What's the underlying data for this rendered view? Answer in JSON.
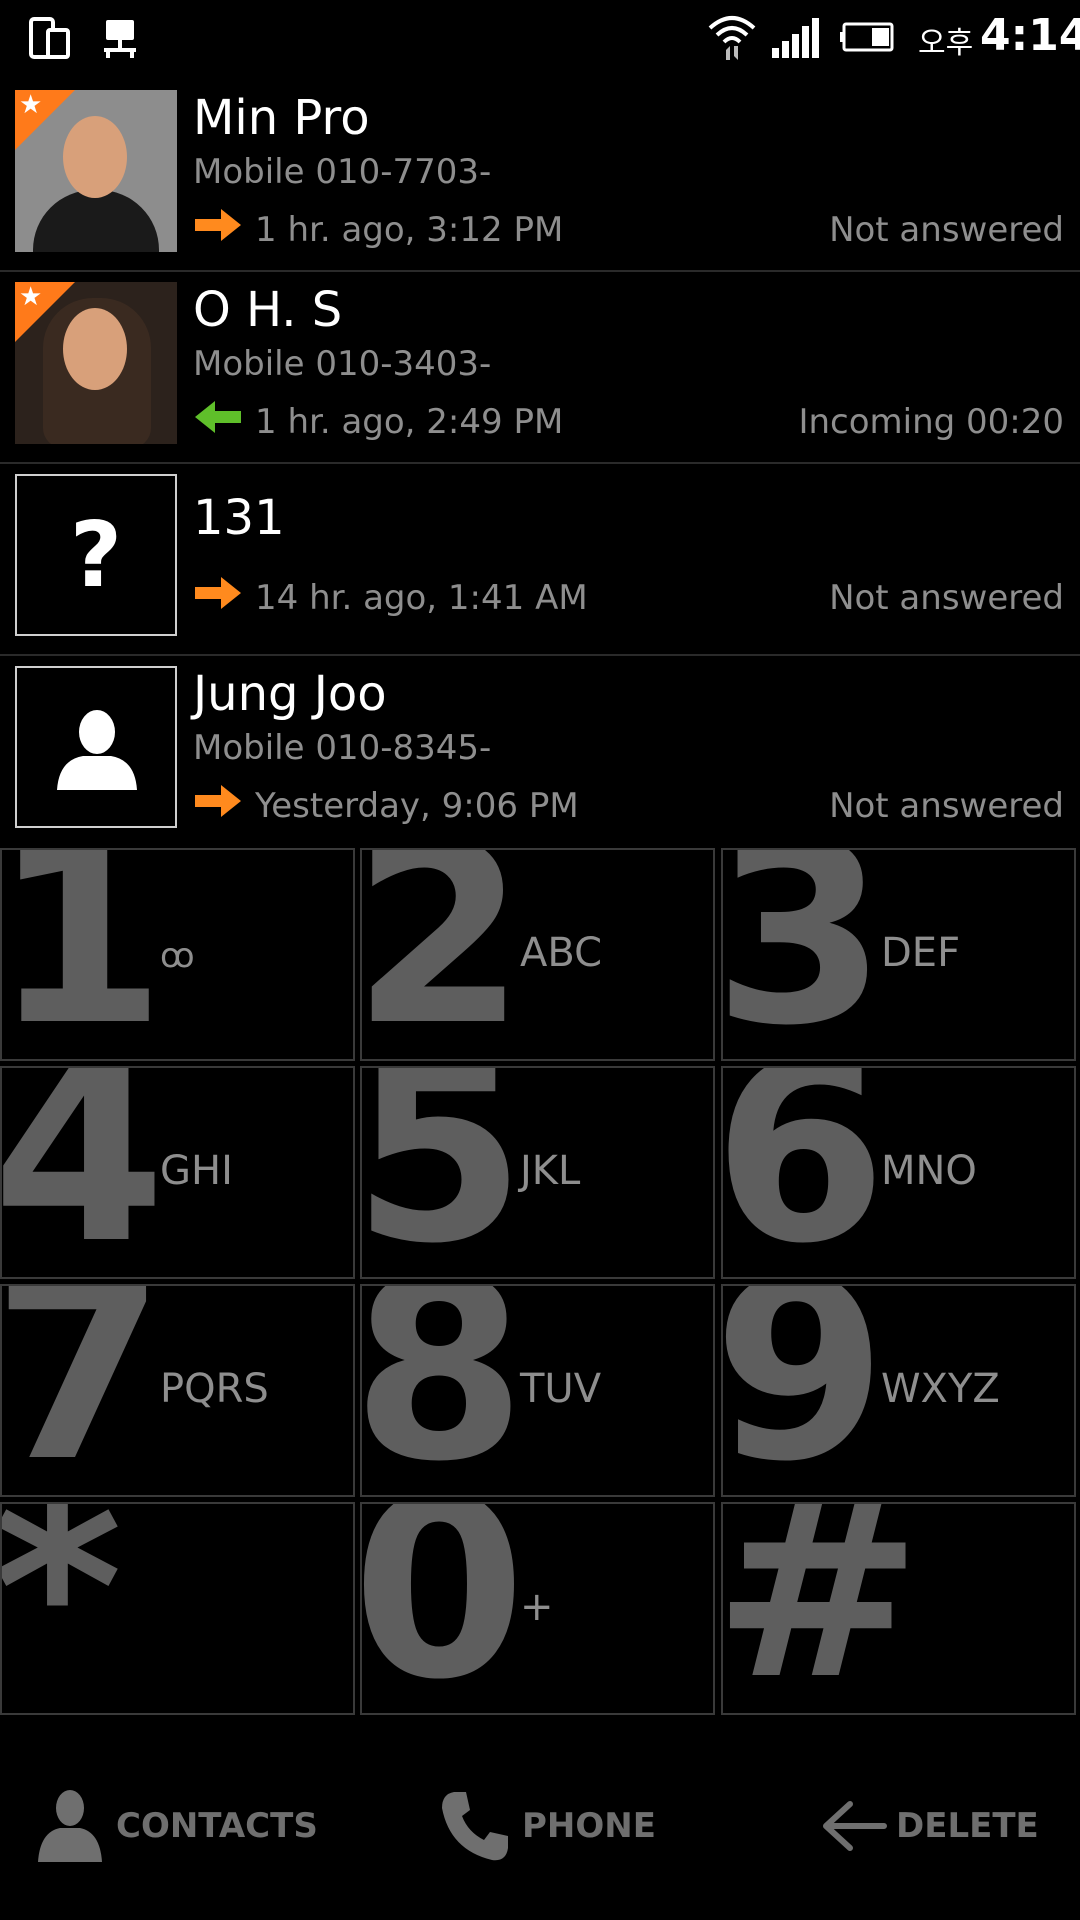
{
  "status_bar": {
    "ampm": "오후",
    "time": "4:14"
  },
  "call_log": [
    {
      "name": "Min Pro",
      "number": "Mobile 010-7703-",
      "when": "1 hr. ago, 3:12 PM",
      "status": "Not answered",
      "direction": "outgoing",
      "avatar": "photo-man"
    },
    {
      "name": "O H. S",
      "number": "Mobile 010-3403-",
      "when": "1 hr. ago, 2:49 PM",
      "status": "Incoming 00:20",
      "direction": "incoming",
      "avatar": "photo-woman"
    },
    {
      "name": "131",
      "number": "",
      "when": "14 hr. ago, 1:41 AM",
      "status": "Not answered",
      "direction": "outgoing",
      "avatar": "unknown"
    },
    {
      "name": "Jung Joo",
      "number": "Mobile 010-8345-",
      "when": "Yesterday, 9:06 PM",
      "status": "Not answered",
      "direction": "outgoing",
      "avatar": "silhouette"
    }
  ],
  "keypad": [
    {
      "digit": "1",
      "letters": "ꝏ"
    },
    {
      "digit": "2",
      "letters": "ABC"
    },
    {
      "digit": "3",
      "letters": "DEF"
    },
    {
      "digit": "4",
      "letters": "GHI"
    },
    {
      "digit": "5",
      "letters": "JKL"
    },
    {
      "digit": "6",
      "letters": "MNO"
    },
    {
      "digit": "7",
      "letters": "PQRS"
    },
    {
      "digit": "8",
      "letters": "TUV"
    },
    {
      "digit": "9",
      "letters": "WXYZ"
    },
    {
      "digit": "*",
      "letters": ""
    },
    {
      "digit": "0",
      "letters": "+"
    },
    {
      "digit": "#",
      "letters": ""
    }
  ],
  "bottom_bar": {
    "contacts_label": "CONTACTS",
    "phone_label": "PHONE",
    "delete_label": "DELETE"
  },
  "colors": {
    "outgoing_arrow": "#ff8a1e",
    "incoming_arrow": "#5fbf2a",
    "star_badge": "#ff7a1a"
  }
}
